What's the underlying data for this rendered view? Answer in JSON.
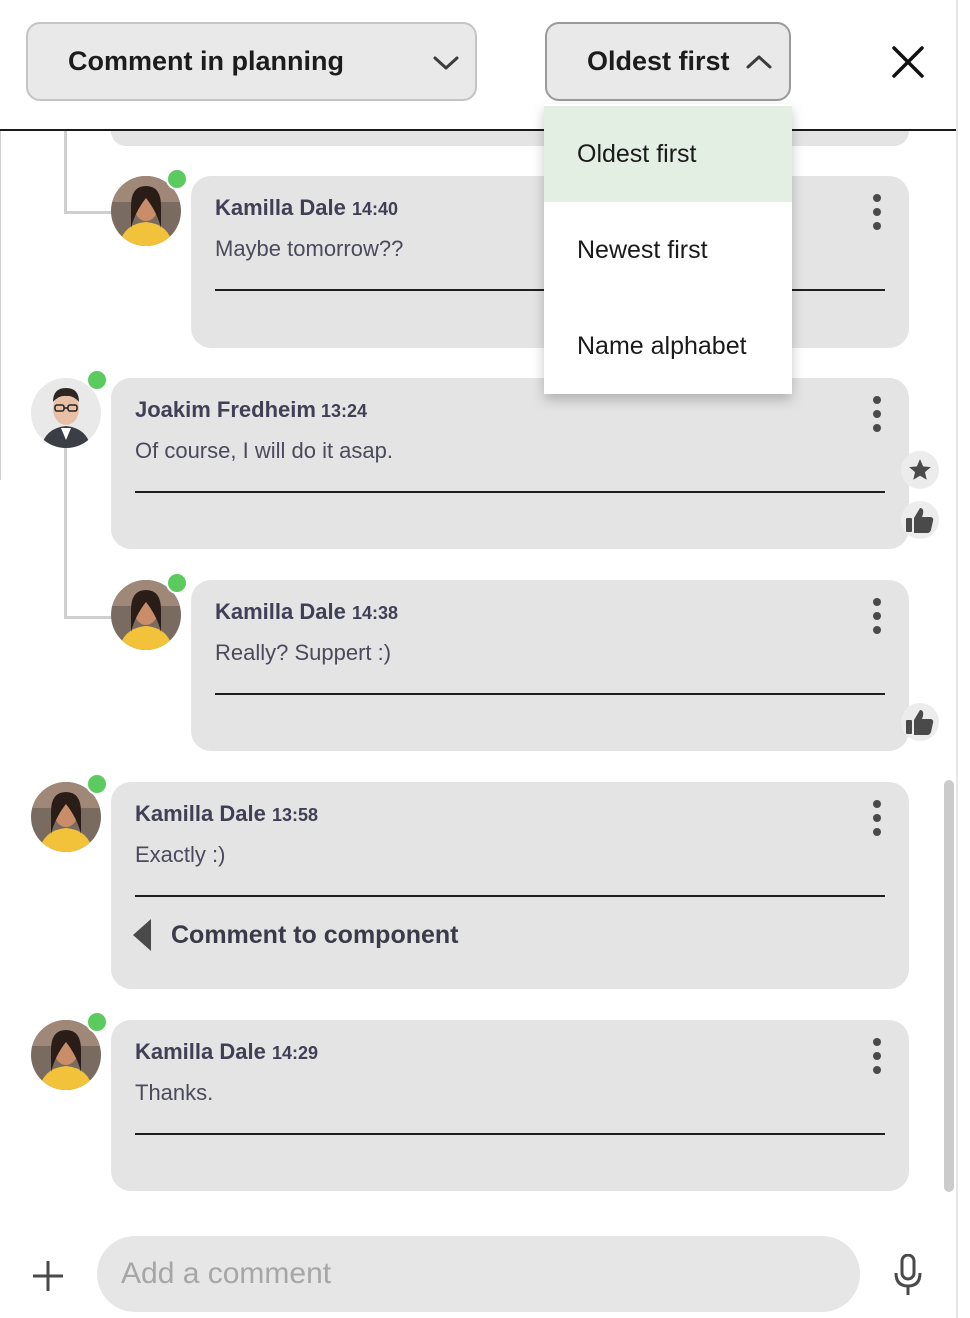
{
  "header": {
    "filter": {
      "label": "Comment in planning",
      "icon": "chevron-down-icon"
    },
    "sort": {
      "label": "Oldest first",
      "icon": "chevron-up-icon"
    },
    "close_icon": "close-icon"
  },
  "sort_menu": {
    "options": [
      "Oldest first",
      "Newest first",
      "Name alphabet"
    ],
    "selected": "Oldest first",
    "selected_color": "#e3efe3"
  },
  "comments": [
    {
      "author": "Kamilla Dale",
      "time": "14:40",
      "text": "Maybe tomorrow??",
      "reply": true,
      "online": true
    },
    {
      "author": "Joakim Fredheim",
      "time": "13:24",
      "text": "Of course, I will do it asap.",
      "reply": false,
      "online": true,
      "reactions": [
        "star-icon",
        "thumbs-up-icon"
      ]
    },
    {
      "author": "Kamilla Dale",
      "time": "14:38",
      "text": "Really? Suppert :)",
      "reply": true,
      "online": true,
      "reactions": [
        "thumbs-up-icon"
      ]
    },
    {
      "author": "Kamilla Dale",
      "time": "13:58",
      "text": "Exactly :)",
      "reply": false,
      "online": true,
      "link_label": "Comment to component"
    },
    {
      "author": "Kamilla Dale",
      "time": "14:29",
      "text": "Thanks.",
      "reply": false,
      "online": true
    }
  ],
  "composer": {
    "placeholder": "Add a comment",
    "add_icon": "plus-icon",
    "mic_icon": "microphone-icon"
  },
  "colors": {
    "card": "#e4e4e4",
    "presence": "#5ccb5f",
    "author": "#3f3f55"
  }
}
